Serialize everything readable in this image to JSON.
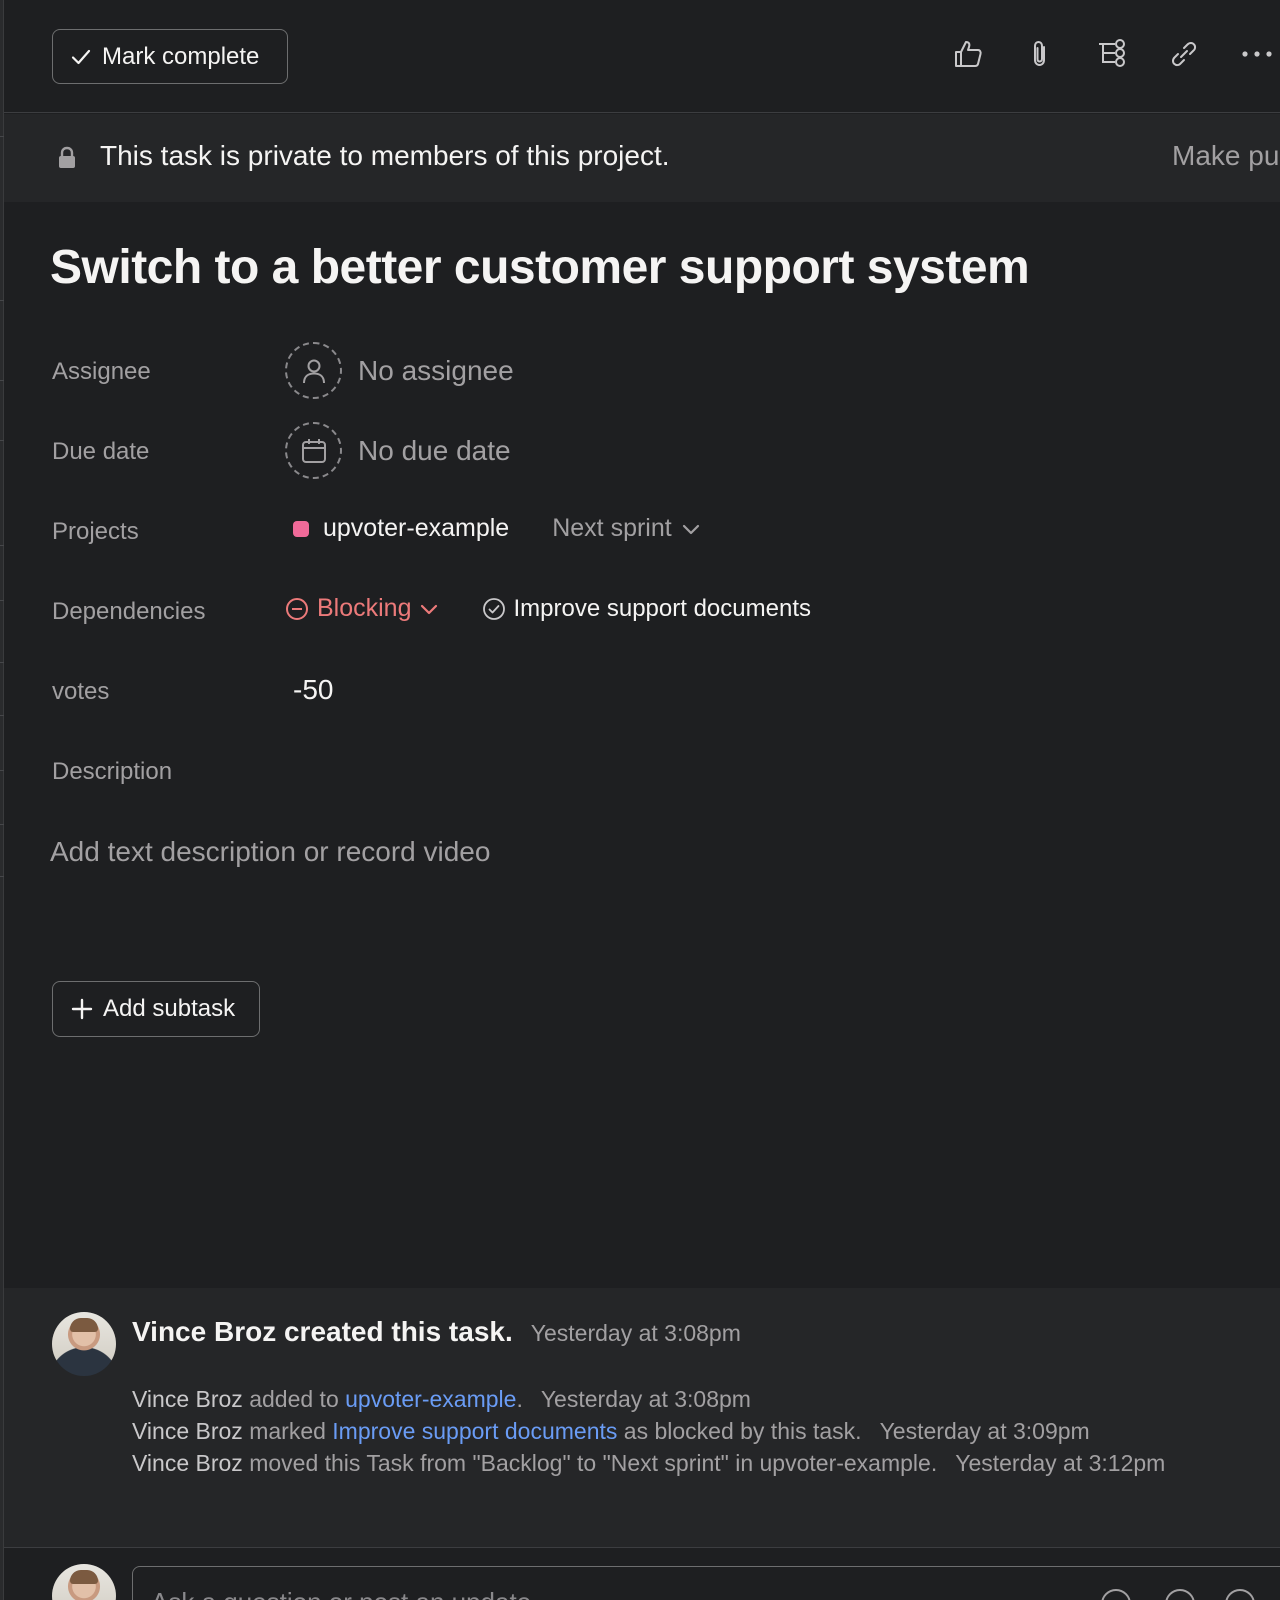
{
  "toolbar": {
    "mark_complete_label": "Mark complete",
    "icons": [
      "thumbs-up-icon",
      "paperclip-icon",
      "subtask-icon",
      "link-icon",
      "more-icon"
    ]
  },
  "banner": {
    "message": "This task is private to members of this project.",
    "make_public_label": "Make pu"
  },
  "task": {
    "title": "Switch to a better customer support system",
    "fields": {
      "assignee_label": "Assignee",
      "assignee_value": "No assignee",
      "due_date_label": "Due date",
      "due_date_value": "No due date",
      "projects_label": "Projects",
      "project_name": "upvoter-example",
      "project_color": "#f06a99",
      "section_name": "Next sprint",
      "dependencies_label": "Dependencies",
      "dependency_type": "Blocking",
      "dependency_task": "Improve support documents",
      "votes_label": "votes",
      "votes_value": "-50",
      "description_label": "Description",
      "description_placeholder": "Add text description or record video"
    },
    "add_subtask_label": "Add subtask"
  },
  "activity": {
    "created": {
      "text": "Vince Broz created this task.",
      "timestamp": "Yesterday at 3:08pm"
    },
    "events": [
      {
        "actor": "Vince Broz",
        "pre": " added to ",
        "link": "upvoter-example",
        "post": ".",
        "timestamp": "Yesterday at 3:08pm"
      },
      {
        "actor": "Vince Broz",
        "pre": " marked ",
        "link": "Improve support documents",
        "post": " as blocked by this task.",
        "timestamp": "Yesterday at 3:09pm"
      },
      {
        "actor": "Vince Broz",
        "pre": " moved this Task from \"Backlog\" to \"Next sprint\" in upvoter-example.",
        "link": "",
        "post": "",
        "timestamp": "Yesterday at 3:12pm"
      }
    ]
  },
  "composer": {
    "placeholder": "Ask a question or post an update..."
  },
  "colors": {
    "background": "#1e1f21",
    "panel": "#252628",
    "blocking": "#ec7a7a",
    "link": "#6a9cf5"
  }
}
